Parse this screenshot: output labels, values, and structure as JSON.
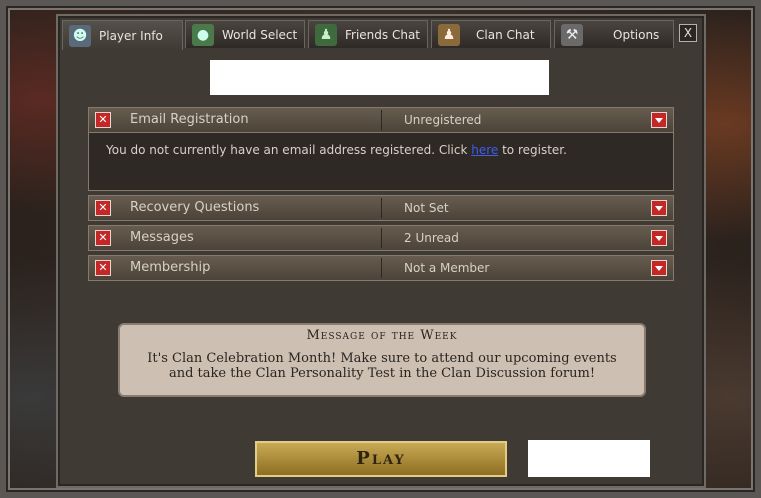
{
  "tabs": [
    {
      "label": "Player Info",
      "icon": "player-icon",
      "active": true
    },
    {
      "label": "World Select",
      "icon": "globe-icon"
    },
    {
      "label": "Friends Chat",
      "icon": "friends-icon"
    },
    {
      "label": "Clan Chat",
      "icon": "clan-icon"
    },
    {
      "label": "Options",
      "icon": "tools-icon"
    }
  ],
  "close_label": "X",
  "rows": [
    {
      "label": "Email Registration",
      "value": "Unregistered"
    },
    {
      "label": "Recovery Questions",
      "value": "Not Set"
    },
    {
      "label": "Messages",
      "value": "2 Unread"
    },
    {
      "label": "Membership",
      "value": "Not a Member"
    }
  ],
  "email": {
    "text_before": "You do not currently have an email address registered. Click ",
    "link": "here",
    "text_after": " to register."
  },
  "motw": {
    "title": "Message of the Week",
    "line1": "It's Clan Celebration Month! Make sure to attend our upcoming events",
    "line2": "and take the Clan Personality Test in the Clan Discussion forum!"
  },
  "play_label": "Play",
  "colors": {
    "accent_red": "#c42826",
    "link_blue": "#3b5ff0",
    "play_gold": "#c8ab55"
  }
}
